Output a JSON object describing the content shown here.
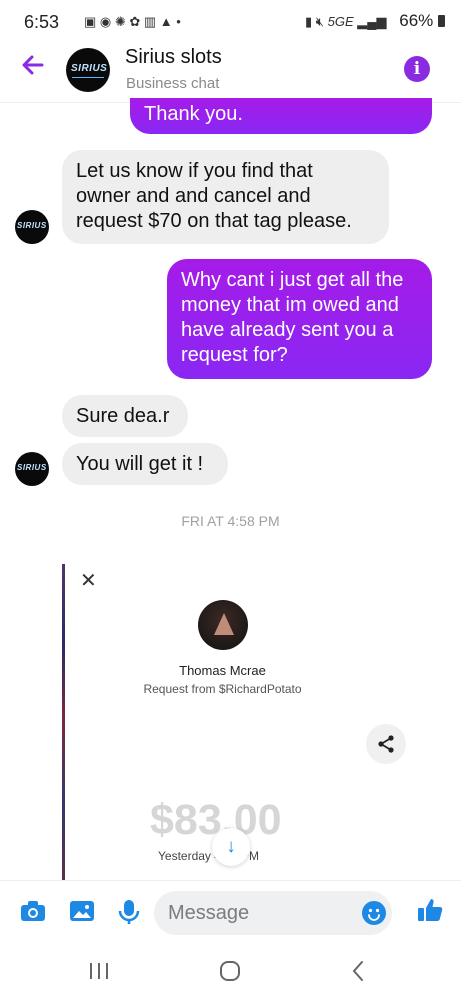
{
  "status": {
    "time": "6:53",
    "network": "5GE",
    "battery": "66%"
  },
  "header": {
    "title": "Sirius slots",
    "subtitle": "Business chat",
    "avatar_logo": "SIRIUS"
  },
  "messages": [
    {
      "from": "me",
      "text": "Thank you."
    },
    {
      "from": "them",
      "lines": [
        "Let us know if you find that",
        "owner and and cancel and",
        "request $70 on that tag please."
      ]
    },
    {
      "from": "me",
      "lines": [
        "Why cant i just get all the",
        "money that im owed and",
        "have already sent you a",
        "request for?"
      ]
    },
    {
      "from": "them",
      "text": "Sure dea.r"
    },
    {
      "from": "them",
      "text": "You will get it !"
    }
  ],
  "timestamp": "FRI AT 4:58 PM",
  "card": {
    "name": "Thomas Mcrae",
    "request": "Request from $RichardPotato",
    "amount": "$83.00",
    "date": "Yesterday 4:44 PM"
  },
  "composer": {
    "placeholder": "Message"
  },
  "colors": {
    "accent": "#8a2be2",
    "outgoing_start": "#a51be8",
    "outgoing_end": "#8a27f3",
    "incoming": "#eeeeef",
    "icon_blue": "#1e88e5"
  },
  "icons": {
    "back": "arrow-left-icon",
    "info": "info-icon",
    "camera": "camera-icon",
    "gallery": "image-icon",
    "mic": "microphone-icon",
    "emoji": "emoji-icon",
    "like": "thumbs-up-icon",
    "share": "share-icon",
    "close": "close-icon",
    "scroll_down": "arrow-down-icon"
  }
}
